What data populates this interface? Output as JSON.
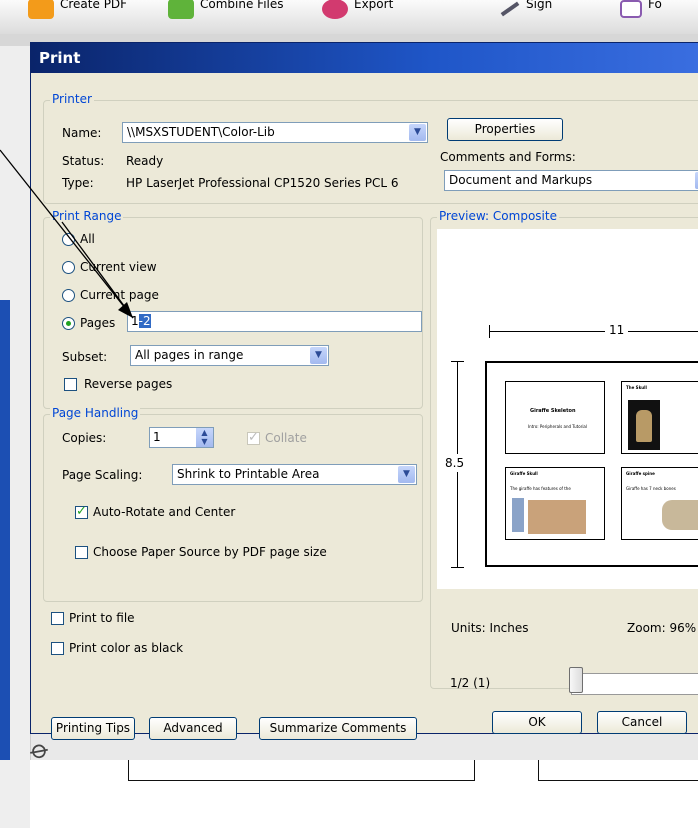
{
  "toolbar": {
    "items": [
      "Create PDF",
      "Combine Files",
      "Export",
      "Sign",
      "Fo"
    ]
  },
  "dialog": {
    "title": "Print",
    "printer": {
      "legend": "Printer",
      "name_label": "Name:",
      "name_value": "\\\\MSXSTUDENT\\Color-Lib",
      "status_label": "Status:",
      "status_value": "Ready",
      "type_label": "Type:",
      "type_value": "HP LaserJet Professional CP1520 Series PCL 6",
      "properties_button": "Properties",
      "comments_label": "Comments and Forms:",
      "comments_value": "Document and Markups"
    },
    "print_range": {
      "legend": "Print Range",
      "all": "All",
      "current_view": "Current view",
      "current_page": "Current page",
      "pages": "Pages",
      "pages_value_a": "1",
      "pages_value_b": "-2",
      "subset_label": "Subset:",
      "subset_value": "All pages in range",
      "reverse_pages": "Reverse pages"
    },
    "page_handling": {
      "legend": "Page Handling",
      "copies_label": "Copies:",
      "copies_value": "1",
      "collate": "Collate",
      "page_scaling_label": "Page Scaling:",
      "page_scaling_value": "Shrink to Printable Area",
      "auto_rotate": "Auto-Rotate and Center",
      "paper_source": "Choose Paper Source by PDF page size"
    },
    "print_to_file": "Print to file",
    "print_color_black": "Print color as black",
    "preview": {
      "legend": "Preview: Composite",
      "width_label": "11",
      "height_label": "8.5",
      "units_label": "Units: Inches",
      "zoom_label": "Zoom:  96%",
      "page_indicator": "1/2 (1)",
      "slide1_title": "Giraffe Skeleton",
      "slide1_sub": "Intro: Peripherals and Tutorial",
      "slide2_title": "The Skull",
      "slide3_title": "Giraffe Skull",
      "slide3_sub": "The giraffe has features of the",
      "slide4_title": "Giraffe spine",
      "slide4_sub": "Giraffe has 7 neck bones"
    },
    "buttons": {
      "printing_tips": "Printing Tips",
      "advanced": "Advanced",
      "summarize_comments": "Summarize Comments",
      "ok": "OK",
      "cancel": "Cancel"
    }
  },
  "colors": {
    "titlebar": "#0a246a",
    "legend_text": "#0046d5",
    "dialog_bg": "#ece9d8"
  }
}
